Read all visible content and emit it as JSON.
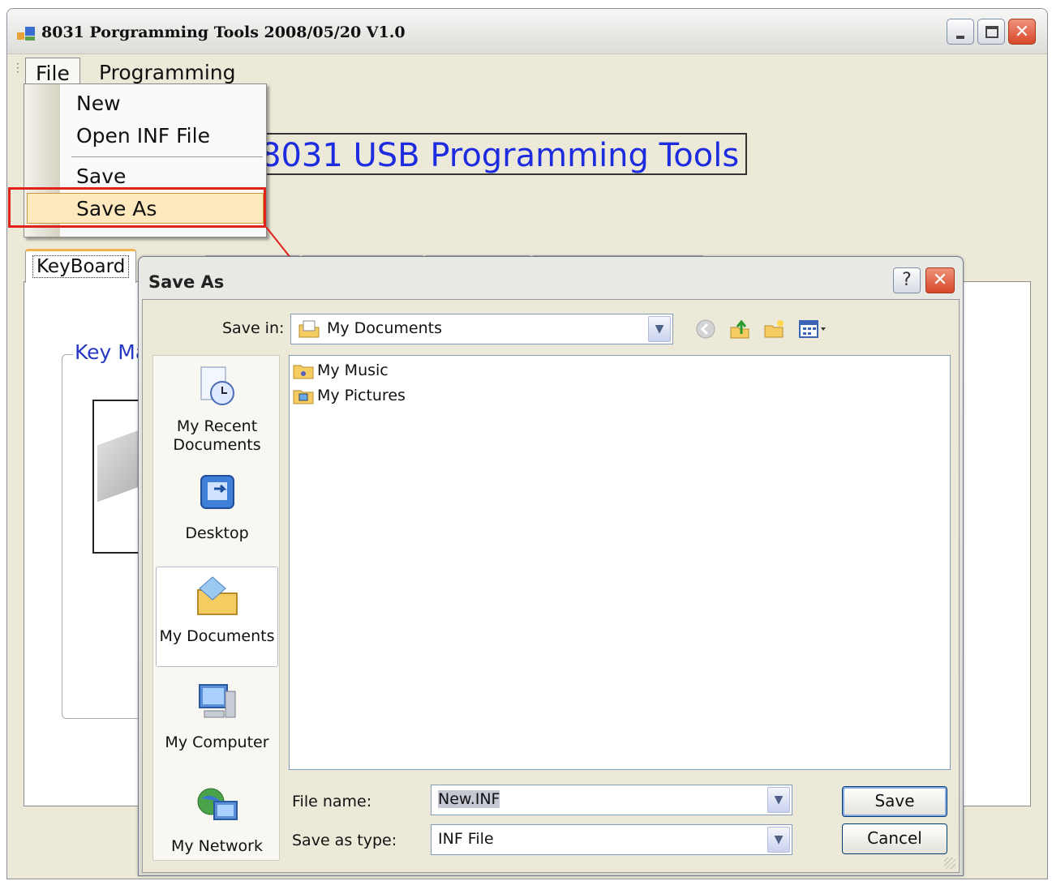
{
  "window": {
    "title": "8031 Porgramming Tools 2008/05/20 V1.0",
    "close_glyph": "✕"
  },
  "menubar": {
    "items": [
      "File",
      "Programming"
    ]
  },
  "file_menu": {
    "items": [
      "New",
      "Open INF File",
      "Save",
      "Save As"
    ],
    "highlighted": "Save As",
    "highlight_color": "#fde9bd",
    "annotation_color": "#e0221b"
  },
  "banner": {
    "text": "8031 USB Programming Tools",
    "color": "#1e2ce0"
  },
  "tabs": {
    "active": "KeyBoard"
  },
  "group": {
    "label": "Key Ma"
  },
  "dialog": {
    "title": "Save As",
    "help_glyph": "?",
    "close_glyph": "✕",
    "save_in_label": "Save in:",
    "save_in_value": "My Documents",
    "places": [
      "My Recent Documents",
      "Desktop",
      "My Documents",
      "My Computer",
      "My Network"
    ],
    "files": [
      "My Music",
      "My Pictures"
    ],
    "file_name_label": "File name:",
    "file_name_value": "New.INF",
    "save_type_label": "Save as type:",
    "save_type_value": "INF File",
    "save_button": "Save",
    "cancel_button": "Cancel",
    "icons": [
      "back-icon",
      "up-folder-icon",
      "new-folder-icon",
      "view-menu-icon"
    ]
  }
}
